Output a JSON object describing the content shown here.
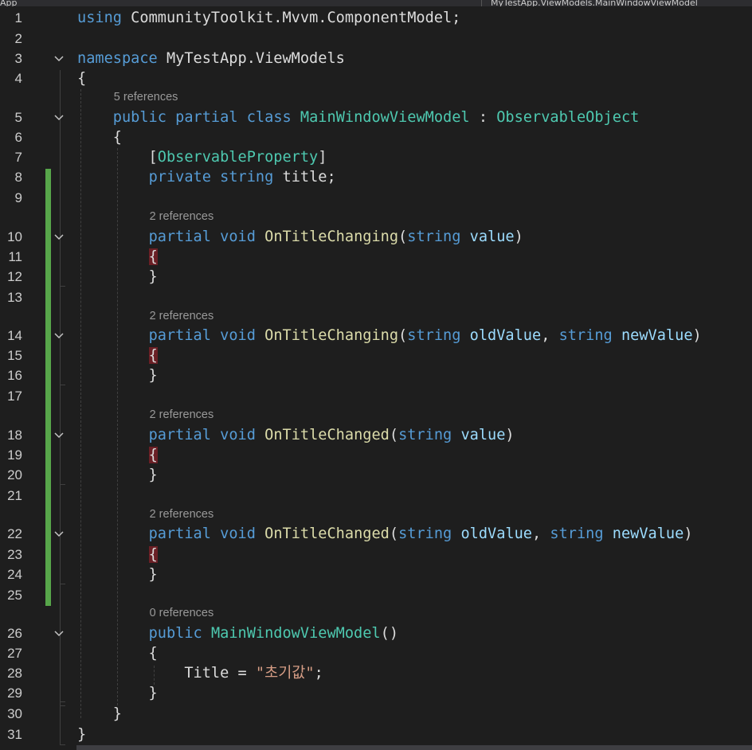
{
  "top_bar": {
    "left_label": "App",
    "right_label": "MyTestApp.ViewModels.MainWindowViewModel"
  },
  "lines": [
    {
      "num": "1",
      "fold": false,
      "changed": false,
      "tokens": [
        [
          "kw",
          "using"
        ],
        [
          "pl",
          " CommunityToolkit.Mvvm.ComponentModel;"
        ]
      ]
    },
    {
      "num": "2",
      "fold": false,
      "changed": false,
      "tokens": []
    },
    {
      "num": "3",
      "fold": true,
      "changed": false,
      "tokens": [
        [
          "kw",
          "namespace"
        ],
        [
          "pl",
          " MyTestApp.ViewModels"
        ]
      ]
    },
    {
      "num": "4",
      "fold": false,
      "changed": false,
      "tokens": [
        [
          "pl",
          "{"
        ]
      ]
    },
    {
      "num": "5",
      "fold": true,
      "changed": false,
      "lens": "5 references",
      "tokens": [
        [
          "pl",
          "    "
        ],
        [
          "kw",
          "public"
        ],
        [
          "pl",
          " "
        ],
        [
          "kw",
          "partial"
        ],
        [
          "pl",
          " "
        ],
        [
          "kw",
          "class"
        ],
        [
          "pl",
          " "
        ],
        [
          "ty",
          "MainWindowViewModel"
        ],
        [
          "pl",
          " : "
        ],
        [
          "ty",
          "ObservableObject"
        ]
      ]
    },
    {
      "num": "6",
      "fold": false,
      "changed": false,
      "tokens": [
        [
          "pl",
          "    {"
        ]
      ]
    },
    {
      "num": "7",
      "fold": false,
      "changed": false,
      "tokens": [
        [
          "pl",
          "        ["
        ],
        [
          "ty",
          "ObservableProperty"
        ],
        [
          "pl",
          "]"
        ]
      ]
    },
    {
      "num": "8",
      "fold": false,
      "changed": true,
      "tokens": [
        [
          "pl",
          "        "
        ],
        [
          "kw",
          "private"
        ],
        [
          "pl",
          " "
        ],
        [
          "kw",
          "string"
        ],
        [
          "pl",
          " title;"
        ]
      ]
    },
    {
      "num": "9",
      "fold": false,
      "changed": true,
      "tokens": []
    },
    {
      "num": "10",
      "fold": true,
      "changed": true,
      "lens": "2 references",
      "tokens": [
        [
          "pl",
          "        "
        ],
        [
          "kw",
          "partial"
        ],
        [
          "pl",
          " "
        ],
        [
          "kw",
          "void"
        ],
        [
          "pl",
          " "
        ],
        [
          "fn",
          "OnTitleChanging"
        ],
        [
          "pl",
          "("
        ],
        [
          "kw",
          "string"
        ],
        [
          "pl",
          " "
        ],
        [
          "pm",
          "value"
        ],
        [
          "pl",
          ")"
        ]
      ]
    },
    {
      "num": "11",
      "fold": false,
      "changed": true,
      "tokens": [
        [
          "pl",
          "        "
        ],
        [
          "hb",
          "{"
        ]
      ]
    },
    {
      "num": "12",
      "fold": false,
      "changed": true,
      "tokens": [
        [
          "pl",
          "        }"
        ]
      ]
    },
    {
      "num": "13",
      "fold": false,
      "changed": true,
      "tokens": []
    },
    {
      "num": "14",
      "fold": true,
      "changed": true,
      "lens": "2 references",
      "tokens": [
        [
          "pl",
          "        "
        ],
        [
          "kw",
          "partial"
        ],
        [
          "pl",
          " "
        ],
        [
          "kw",
          "void"
        ],
        [
          "pl",
          " "
        ],
        [
          "fn",
          "OnTitleChanging"
        ],
        [
          "pl",
          "("
        ],
        [
          "kw",
          "string"
        ],
        [
          "pl",
          " "
        ],
        [
          "pm",
          "oldValue"
        ],
        [
          "pl",
          ", "
        ],
        [
          "kw",
          "string"
        ],
        [
          "pl",
          " "
        ],
        [
          "pm",
          "newValue"
        ],
        [
          "pl",
          ")"
        ]
      ]
    },
    {
      "num": "15",
      "fold": false,
      "changed": true,
      "tokens": [
        [
          "pl",
          "        "
        ],
        [
          "hb",
          "{"
        ]
      ]
    },
    {
      "num": "16",
      "fold": false,
      "changed": true,
      "tokens": [
        [
          "pl",
          "        }"
        ]
      ]
    },
    {
      "num": "17",
      "fold": false,
      "changed": true,
      "tokens": []
    },
    {
      "num": "18",
      "fold": true,
      "changed": true,
      "lens": "2 references",
      "tokens": [
        [
          "pl",
          "        "
        ],
        [
          "kw",
          "partial"
        ],
        [
          "pl",
          " "
        ],
        [
          "kw",
          "void"
        ],
        [
          "pl",
          " "
        ],
        [
          "fn",
          "OnTitleChanged"
        ],
        [
          "pl",
          "("
        ],
        [
          "kw",
          "string"
        ],
        [
          "pl",
          " "
        ],
        [
          "pm",
          "value"
        ],
        [
          "pl",
          ")"
        ]
      ]
    },
    {
      "num": "19",
      "fold": false,
      "changed": true,
      "tokens": [
        [
          "pl",
          "        "
        ],
        [
          "hb",
          "{"
        ]
      ]
    },
    {
      "num": "20",
      "fold": false,
      "changed": true,
      "tokens": [
        [
          "pl",
          "        }"
        ]
      ]
    },
    {
      "num": "21",
      "fold": false,
      "changed": true,
      "tokens": []
    },
    {
      "num": "22",
      "fold": true,
      "changed": true,
      "lens": "2 references",
      "tokens": [
        [
          "pl",
          "        "
        ],
        [
          "kw",
          "partial"
        ],
        [
          "pl",
          " "
        ],
        [
          "kw",
          "void"
        ],
        [
          "pl",
          " "
        ],
        [
          "fn",
          "OnTitleChanged"
        ],
        [
          "pl",
          "("
        ],
        [
          "kw",
          "string"
        ],
        [
          "pl",
          " "
        ],
        [
          "pm",
          "oldValue"
        ],
        [
          "pl",
          ", "
        ],
        [
          "kw",
          "string"
        ],
        [
          "pl",
          " "
        ],
        [
          "pm",
          "newValue"
        ],
        [
          "pl",
          ")"
        ]
      ]
    },
    {
      "num": "23",
      "fold": false,
      "changed": true,
      "tokens": [
        [
          "pl",
          "        "
        ],
        [
          "hb",
          "{"
        ]
      ]
    },
    {
      "num": "24",
      "fold": false,
      "changed": true,
      "tokens": [
        [
          "pl",
          "        }"
        ]
      ]
    },
    {
      "num": "25",
      "fold": false,
      "changed": true,
      "tokens": []
    },
    {
      "num": "26",
      "fold": true,
      "changed": false,
      "lens": "0 references",
      "tokens": [
        [
          "pl",
          "        "
        ],
        [
          "kw",
          "public"
        ],
        [
          "pl",
          " "
        ],
        [
          "ty",
          "MainWindowViewModel"
        ],
        [
          "pl",
          "()"
        ]
      ]
    },
    {
      "num": "27",
      "fold": false,
      "changed": false,
      "tokens": [
        [
          "pl",
          "        {"
        ]
      ]
    },
    {
      "num": "28",
      "fold": false,
      "changed": false,
      "tokens": [
        [
          "pl",
          "            Title = "
        ],
        [
          "st",
          "\"초기값\""
        ],
        [
          "pl",
          ";"
        ]
      ]
    },
    {
      "num": "29",
      "fold": false,
      "changed": false,
      "tokens": [
        [
          "pl",
          "        }"
        ]
      ]
    },
    {
      "num": "30",
      "fold": false,
      "changed": false,
      "tokens": [
        [
          "pl",
          "    }"
        ]
      ]
    },
    {
      "num": "31",
      "fold": false,
      "changed": false,
      "tokens": [
        [
          "pl",
          "}"
        ]
      ]
    }
  ],
  "colors": {
    "background": "#1e1e1e",
    "keyword": "#569cd6",
    "type": "#4ec9b0",
    "method": "#dcdcaa",
    "parameter": "#9cdcfe",
    "string": "#d69d85",
    "plain": "#dcdcdc",
    "line_number": "#cccccc",
    "codelens": "#999999",
    "change_bar": "#57a64a",
    "brace_highlight": "#6a1f25"
  },
  "icons": {
    "fold": "chevron-down-icon"
  }
}
